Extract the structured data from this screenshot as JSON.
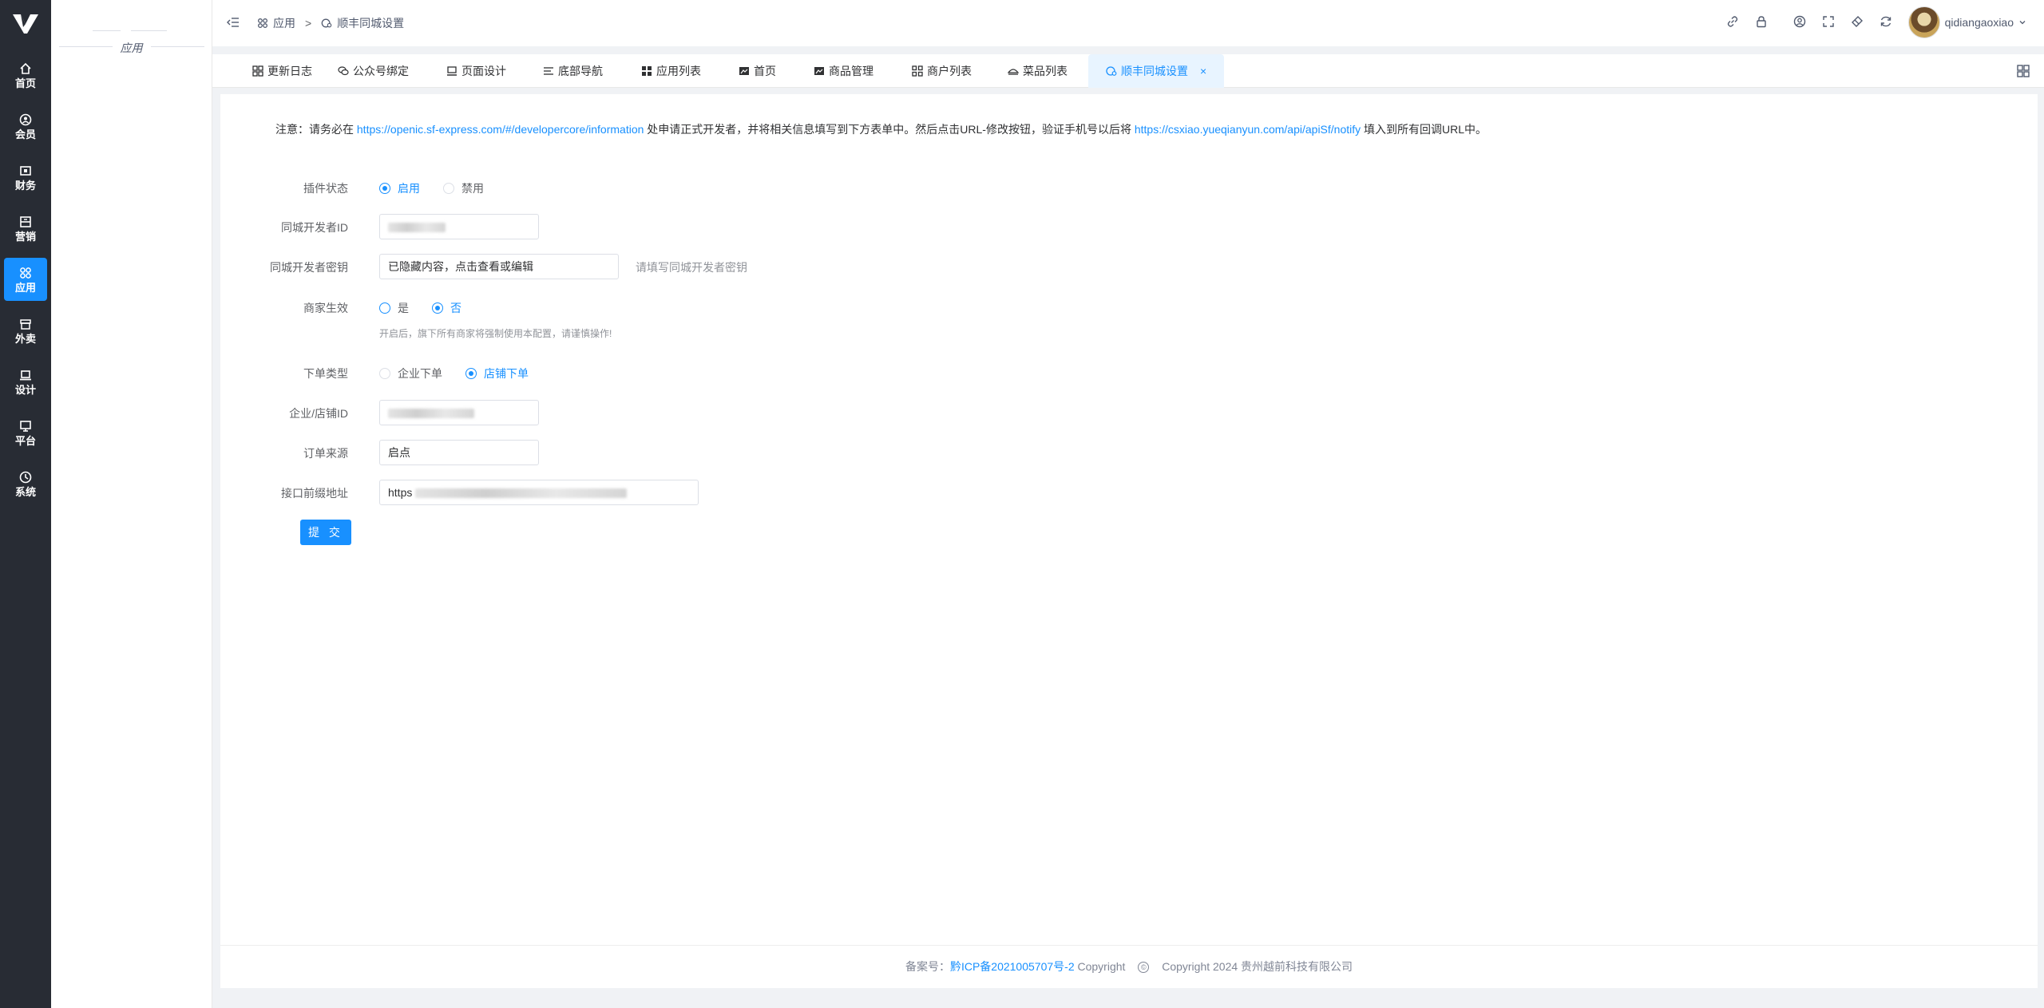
{
  "sidebar": {
    "items": [
      {
        "label": "首页",
        "icon": "home-icon"
      },
      {
        "label": "会员",
        "icon": "member-icon"
      },
      {
        "label": "财务",
        "icon": "finance-icon"
      },
      {
        "label": "营销",
        "icon": "marketing-icon"
      },
      {
        "label": "应用",
        "icon": "apps-icon",
        "active": true
      },
      {
        "label": "外卖",
        "icon": "takeaway-icon"
      },
      {
        "label": "设计",
        "icon": "design-icon"
      },
      {
        "label": "平台",
        "icon": "platform-icon"
      },
      {
        "label": "系统",
        "icon": "system-icon"
      }
    ]
  },
  "subnav": {
    "title": "应用"
  },
  "header": {
    "breadcrumb": {
      "root": "应用",
      "separator": ">",
      "current": "顺丰同城设置"
    },
    "username": "qidiangaoxiao"
  },
  "tabs": [
    {
      "label": "更新日志"
    },
    {
      "label": "公众号绑定"
    },
    {
      "label": "页面设计"
    },
    {
      "label": "底部导航"
    },
    {
      "label": "应用列表"
    },
    {
      "label": "首页"
    },
    {
      "label": "商品管理"
    },
    {
      "label": "商户列表"
    },
    {
      "label": "菜品列表"
    },
    {
      "label": "顺丰同城设置",
      "active": true,
      "close": "×"
    }
  ],
  "notice": {
    "prefix": "注意：请务必在",
    "link1": "https://openic.sf-express.com/#/developercore/information",
    "middle": "处申请正式开发者，并将相关信息填写到下方表单中。然后点击URL-修改按钮，验证手机号以后将",
    "link2": "https://csxiao.yueqianyun.com/api/apiSf/notify",
    "suffix": "填入到所有回调URL中。"
  },
  "form": {
    "plugin_status": {
      "label": "插件状态",
      "options": [
        "启用",
        "禁用"
      ],
      "selected": "启用"
    },
    "dev_id": {
      "label": "同城开发者ID"
    },
    "dev_secret": {
      "label": "同城开发者密钥",
      "value": "已隐藏内容，点击查看或编辑",
      "hint": "请填写同城开发者密钥"
    },
    "merchant_effect": {
      "label": "商家生效",
      "options": [
        "是",
        "否"
      ],
      "selected": "否",
      "help": "开启后，旗下所有商家将强制使用本配置，请谨慎操作!"
    },
    "order_type": {
      "label": "下单类型",
      "options": [
        "企业下单",
        "店铺下单"
      ],
      "selected": "店铺下单"
    },
    "shop_id": {
      "label": "企业/店铺ID"
    },
    "order_source": {
      "label": "订单来源",
      "value": "启点"
    },
    "api_prefix": {
      "label": "接口前缀地址",
      "value": "https"
    },
    "submit_label": "提 交"
  },
  "footer": {
    "icp_prefix": "备案号：",
    "icp_link": "黔ICP备2021005707号-2",
    "copyright_word": "Copyright",
    "copyright_text": "Copyright 2024 贵州越前科技有限公司"
  },
  "colors": {
    "primary": "#1890ff",
    "sidebar_bg": "#282c34"
  }
}
